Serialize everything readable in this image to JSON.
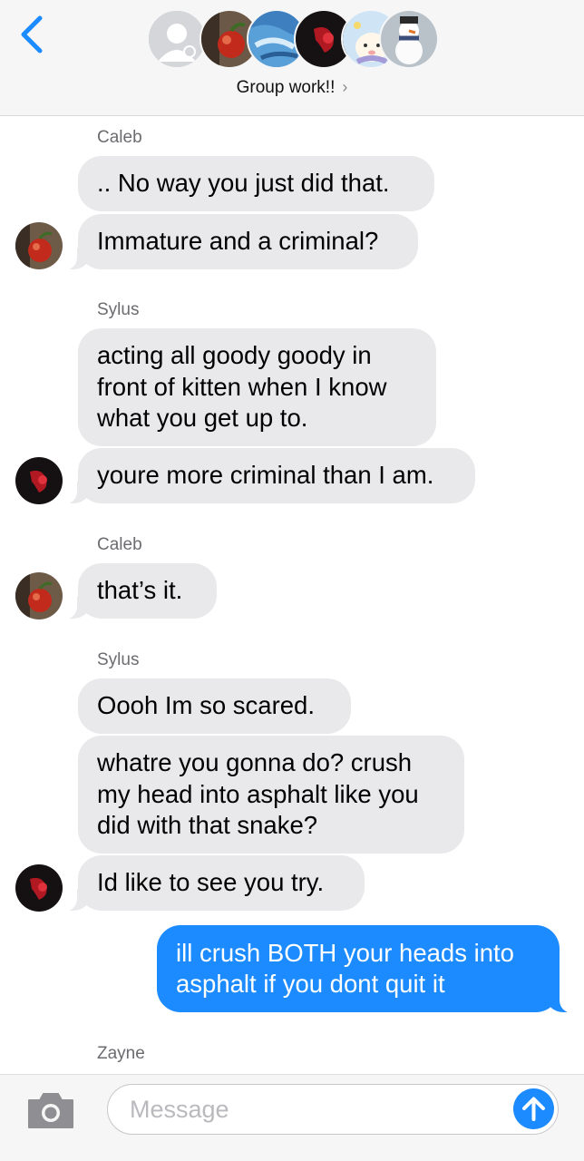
{
  "header": {
    "group_name": "Group work!!",
    "chevron": "›",
    "avatars": [
      "default-person-icon",
      "apple-photo",
      "blue-ocean-photo",
      "red-dark-photo",
      "cartoon-bear-photo",
      "snowman-photo"
    ]
  },
  "messages": [
    {
      "sender": "Caleb",
      "lines": [
        ".. No way you just did that."
      ]
    },
    {
      "lines": [
        "Immature and a criminal?"
      ]
    },
    {
      "sender": "Sylus",
      "lines": [
        "acting all goody goody in",
        "front of kitten when I know",
        "what you get up to."
      ]
    },
    {
      "lines": [
        "youre more criminal than I am."
      ]
    },
    {
      "sender": "Caleb",
      "lines": [
        "that’s it."
      ]
    },
    {
      "sender": "Sylus",
      "lines": [
        "Oooh Im so scared."
      ]
    },
    {
      "lines": [
        "whatre you gonna do?  crush",
        "my head into asphalt like you",
        "did with that snake?"
      ]
    },
    {
      "lines": [
        "Id like to see you try."
      ]
    },
    {
      "outgoing": true,
      "lines": [
        "ill crush BOTH your heads into",
        "asphalt if you dont quit it"
      ]
    },
    {
      "sender": "Zayne"
    }
  ],
  "input": {
    "placeholder": "Message"
  },
  "colors": {
    "accent": "#1c8bff",
    "incoming_bubble": "#e9e9eb",
    "header_bg": "#f6f6f6"
  }
}
